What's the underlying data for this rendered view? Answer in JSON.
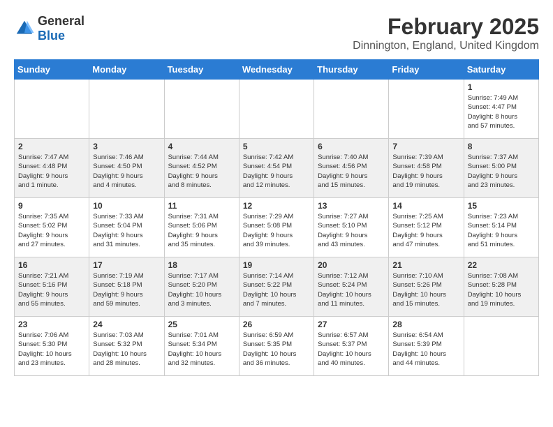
{
  "header": {
    "logo_general": "General",
    "logo_blue": "Blue",
    "title": "February 2025",
    "subtitle": "Dinnington, England, United Kingdom"
  },
  "weekdays": [
    "Sunday",
    "Monday",
    "Tuesday",
    "Wednesday",
    "Thursday",
    "Friday",
    "Saturday"
  ],
  "weeks": [
    [
      {
        "day": "",
        "info": ""
      },
      {
        "day": "",
        "info": ""
      },
      {
        "day": "",
        "info": ""
      },
      {
        "day": "",
        "info": ""
      },
      {
        "day": "",
        "info": ""
      },
      {
        "day": "",
        "info": ""
      },
      {
        "day": "1",
        "info": "Sunrise: 7:49 AM\nSunset: 4:47 PM\nDaylight: 8 hours\nand 57 minutes."
      }
    ],
    [
      {
        "day": "2",
        "info": "Sunrise: 7:47 AM\nSunset: 4:48 PM\nDaylight: 9 hours\nand 1 minute."
      },
      {
        "day": "3",
        "info": "Sunrise: 7:46 AM\nSunset: 4:50 PM\nDaylight: 9 hours\nand 4 minutes."
      },
      {
        "day": "4",
        "info": "Sunrise: 7:44 AM\nSunset: 4:52 PM\nDaylight: 9 hours\nand 8 minutes."
      },
      {
        "day": "5",
        "info": "Sunrise: 7:42 AM\nSunset: 4:54 PM\nDaylight: 9 hours\nand 12 minutes."
      },
      {
        "day": "6",
        "info": "Sunrise: 7:40 AM\nSunset: 4:56 PM\nDaylight: 9 hours\nand 15 minutes."
      },
      {
        "day": "7",
        "info": "Sunrise: 7:39 AM\nSunset: 4:58 PM\nDaylight: 9 hours\nand 19 minutes."
      },
      {
        "day": "8",
        "info": "Sunrise: 7:37 AM\nSunset: 5:00 PM\nDaylight: 9 hours\nand 23 minutes."
      }
    ],
    [
      {
        "day": "9",
        "info": "Sunrise: 7:35 AM\nSunset: 5:02 PM\nDaylight: 9 hours\nand 27 minutes."
      },
      {
        "day": "10",
        "info": "Sunrise: 7:33 AM\nSunset: 5:04 PM\nDaylight: 9 hours\nand 31 minutes."
      },
      {
        "day": "11",
        "info": "Sunrise: 7:31 AM\nSunset: 5:06 PM\nDaylight: 9 hours\nand 35 minutes."
      },
      {
        "day": "12",
        "info": "Sunrise: 7:29 AM\nSunset: 5:08 PM\nDaylight: 9 hours\nand 39 minutes."
      },
      {
        "day": "13",
        "info": "Sunrise: 7:27 AM\nSunset: 5:10 PM\nDaylight: 9 hours\nand 43 minutes."
      },
      {
        "day": "14",
        "info": "Sunrise: 7:25 AM\nSunset: 5:12 PM\nDaylight: 9 hours\nand 47 minutes."
      },
      {
        "day": "15",
        "info": "Sunrise: 7:23 AM\nSunset: 5:14 PM\nDaylight: 9 hours\nand 51 minutes."
      }
    ],
    [
      {
        "day": "16",
        "info": "Sunrise: 7:21 AM\nSunset: 5:16 PM\nDaylight: 9 hours\nand 55 minutes."
      },
      {
        "day": "17",
        "info": "Sunrise: 7:19 AM\nSunset: 5:18 PM\nDaylight: 9 hours\nand 59 minutes."
      },
      {
        "day": "18",
        "info": "Sunrise: 7:17 AM\nSunset: 5:20 PM\nDaylight: 10 hours\nand 3 minutes."
      },
      {
        "day": "19",
        "info": "Sunrise: 7:14 AM\nSunset: 5:22 PM\nDaylight: 10 hours\nand 7 minutes."
      },
      {
        "day": "20",
        "info": "Sunrise: 7:12 AM\nSunset: 5:24 PM\nDaylight: 10 hours\nand 11 minutes."
      },
      {
        "day": "21",
        "info": "Sunrise: 7:10 AM\nSunset: 5:26 PM\nDaylight: 10 hours\nand 15 minutes."
      },
      {
        "day": "22",
        "info": "Sunrise: 7:08 AM\nSunset: 5:28 PM\nDaylight: 10 hours\nand 19 minutes."
      }
    ],
    [
      {
        "day": "23",
        "info": "Sunrise: 7:06 AM\nSunset: 5:30 PM\nDaylight: 10 hours\nand 23 minutes."
      },
      {
        "day": "24",
        "info": "Sunrise: 7:03 AM\nSunset: 5:32 PM\nDaylight: 10 hours\nand 28 minutes."
      },
      {
        "day": "25",
        "info": "Sunrise: 7:01 AM\nSunset: 5:34 PM\nDaylight: 10 hours\nand 32 minutes."
      },
      {
        "day": "26",
        "info": "Sunrise: 6:59 AM\nSunset: 5:35 PM\nDaylight: 10 hours\nand 36 minutes."
      },
      {
        "day": "27",
        "info": "Sunrise: 6:57 AM\nSunset: 5:37 PM\nDaylight: 10 hours\nand 40 minutes."
      },
      {
        "day": "28",
        "info": "Sunrise: 6:54 AM\nSunset: 5:39 PM\nDaylight: 10 hours\nand 44 minutes."
      },
      {
        "day": "",
        "info": ""
      }
    ]
  ]
}
